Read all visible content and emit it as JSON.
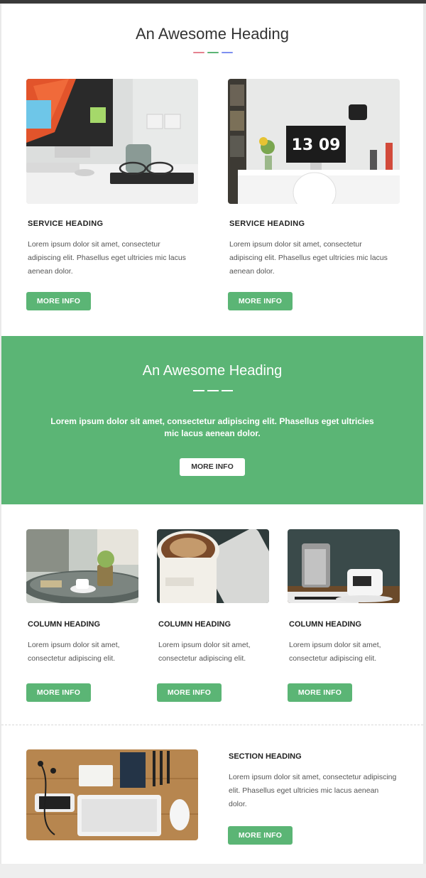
{
  "colors": {
    "accent_green": "#5bb575",
    "divider_red": "#e5828f",
    "divider_green": "#5bb575",
    "divider_blue": "#7d8ff0"
  },
  "section1": {
    "heading": "An Awesome Heading",
    "services": [
      {
        "title": "SERVICE HEADING",
        "text": "Lorem ipsum dolor sit amet, consectetur adipiscing elit. Phasellus eget ultricies mic lacus aenean dolor.",
        "button": "MORE INFO",
        "image": "desk-with-imac-and-glasses"
      },
      {
        "title": "SERVICE HEADING",
        "text": "Lorem ipsum dolor sit amet, consectetur adipiscing elit. Phasellus eget ultricies mic lacus aenean dolor.",
        "button": "MORE INFO",
        "image": "desk-with-clock-monitor",
        "clock_text": "13 09"
      }
    ]
  },
  "section2": {
    "heading": "An Awesome Heading",
    "text": "Lorem ipsum dolor sit amet, consectetur adipiscing elit. Phasellus eget ultricies mic lacus aenean dolor.",
    "button": "MORE INFO"
  },
  "section3": {
    "columns": [
      {
        "title": "COLUMN HEADING",
        "text": "Lorem ipsum dolor sit amet, consectetur adipiscing elit.",
        "button": "MORE INFO",
        "image": "cafe-table-with-cup"
      },
      {
        "title": "COLUMN HEADING",
        "text": "Lorem ipsum dolor sit amet, consectetur adipiscing elit.",
        "button": "MORE INFO",
        "image": "coffee-cup-and-phone"
      },
      {
        "title": "COLUMN HEADING",
        "text": "Lorem ipsum dolor sit amet, consectetur adipiscing elit.",
        "button": "MORE INFO",
        "image": "moka-pot-and-mug"
      }
    ]
  },
  "section4": {
    "title": "SECTION HEADING",
    "text": "Lorem ipsum dolor sit amet, consectetur adipiscing elit. Phasellus eget ultricies mic lacus aenean dolor.",
    "button": "MORE INFO",
    "image": "wooden-desk-with-keyboard"
  }
}
